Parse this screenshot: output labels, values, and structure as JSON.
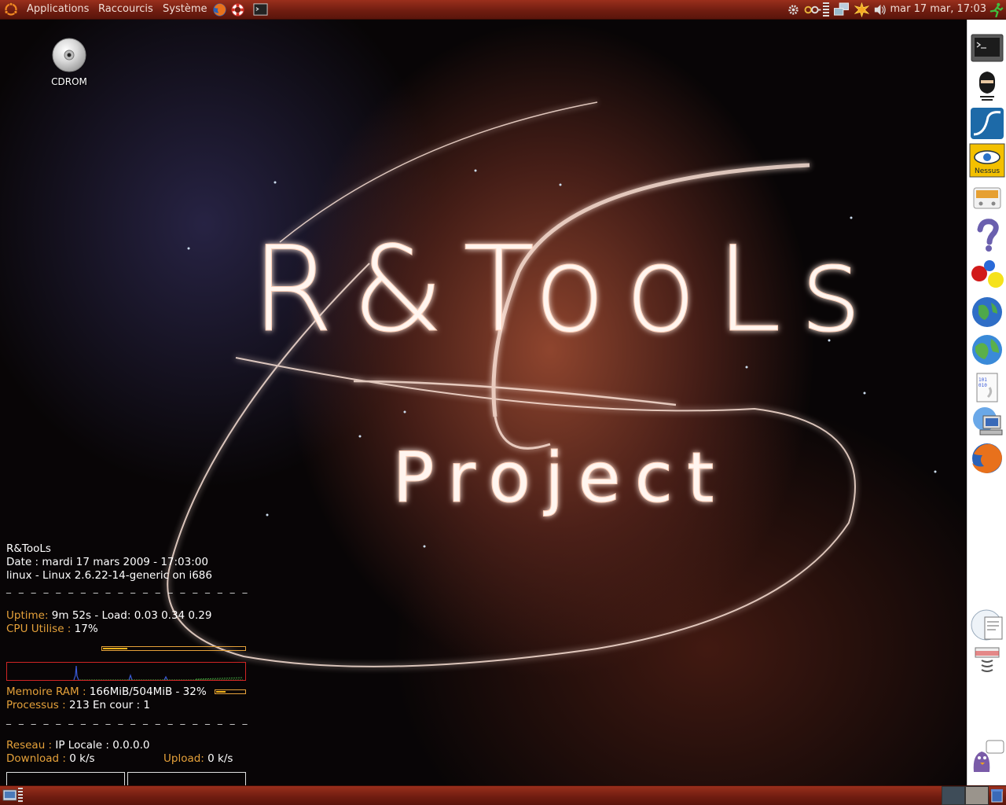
{
  "top_panel": {
    "menus": [
      {
        "label": "Applications"
      },
      {
        "label": "Raccourcis"
      },
      {
        "label": "Système"
      }
    ],
    "launchers": [
      "firefox-icon",
      "help-lifebuoy-icon",
      "terminal-icon"
    ],
    "tray": [
      "network-gear-icon",
      "keys-icon",
      "network-monitor-icon",
      "update-notifier-icon",
      "volume-icon"
    ],
    "clock": "mar 17 mar, 17:03",
    "logout_icon": "running-man-icon"
  },
  "desktop": {
    "icons": [
      {
        "label": "CDROM",
        "icon": "cd-icon"
      }
    ],
    "wallpaper": {
      "title": "R&TooLs",
      "subtitle": "Project"
    }
  },
  "conky": {
    "title": "R&TooLs",
    "date_line": "Date : mardi 17 mars 2009 - 17:03:00",
    "kernel_line": "linux - Linux 2.6.22-14-generic on i686",
    "dashes": "_ _ _ _ _ _ _ _ _ _ _ _ _ _ _ _ _ _ _ _",
    "uptime_label": "Uptime:",
    "uptime_value": "9m 52s - Load: 0.03 0.34 0.29",
    "cpu_label": "CPU Utilise :",
    "cpu_value": "17%",
    "cpu_percent": 17,
    "ram_label": "Memoire RAM :",
    "ram_value": "166MiB/504MiB - 32%",
    "ram_percent": 32,
    "proc_label": "Processus :",
    "proc_value": "213 En cour :",
    "proc_running": "1",
    "net_label": "Reseau :",
    "net_ip": "IP Locale : 0.0.0.0",
    "download_label": "Download :",
    "download_value": "0 k/s",
    "upload_label": "Upload:",
    "upload_value": "0 k/s",
    "colors": {
      "label": "#e5a13a",
      "bar": "#f2b21b",
      "graph_border": "#d02424"
    }
  },
  "dock": {
    "items": [
      {
        "icon": "terminal-icon"
      },
      {
        "icon": "ninja-icon"
      },
      {
        "icon": "wireshark-fin-icon"
      },
      {
        "icon": "nessus-eye-icon",
        "label": "Nessus"
      },
      {
        "icon": "router-device-icon"
      },
      {
        "icon": "question-mark-icon"
      },
      {
        "icon": "colored-balls-icon"
      },
      {
        "icon": "globe-network-icon"
      },
      {
        "icon": "globe-icon"
      },
      {
        "icon": "binary-document-icon"
      },
      {
        "icon": "network-computer-icon"
      },
      {
        "icon": "firefox-icon"
      },
      {
        "icon": "presentation-document-icon"
      },
      {
        "icon": "printer-network-icon"
      },
      {
        "icon": "pidgin-chat-icon"
      }
    ]
  },
  "bottom_panel": {
    "show_desktop_icon": "show-desktop-icon",
    "workspaces": [
      "workspace-1",
      "workspace-2"
    ],
    "trash_icon": "trash-icon"
  }
}
